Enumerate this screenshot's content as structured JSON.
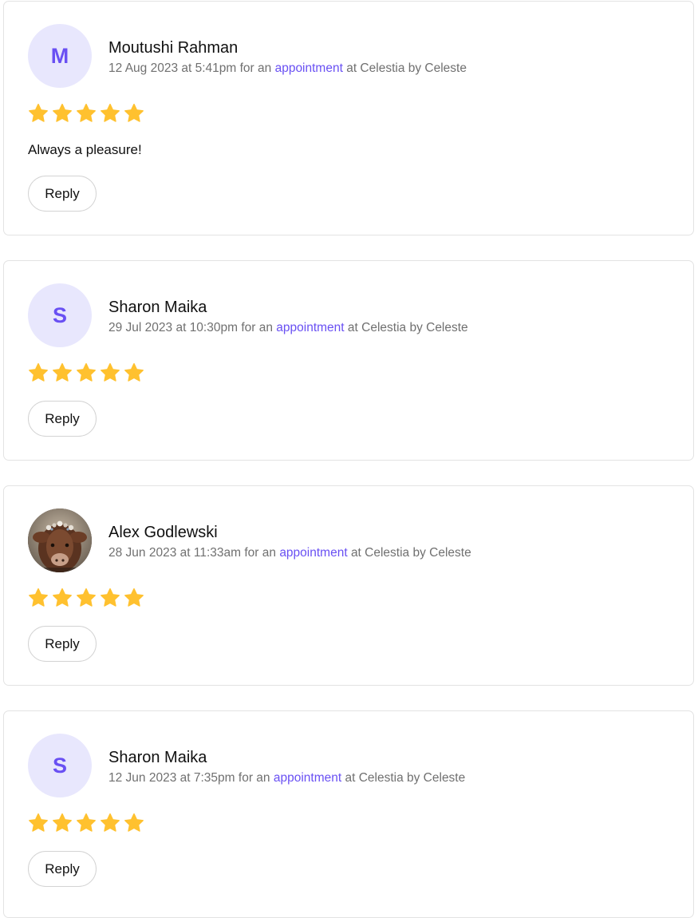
{
  "colors": {
    "accent": "#6950f3",
    "avatar_bg": "#e8e7fd",
    "star": "#ffc12f",
    "meta_text": "#707070",
    "border": "#e3e3e3"
  },
  "reviews": [
    {
      "avatar_type": "initial",
      "avatar_initial": "M",
      "name": "Moutushi Rahman",
      "date": "12 Aug 2023 at 5:41pm",
      "meta_for": "for an",
      "link_label": "appointment",
      "meta_at": "at Celestia by Celeste",
      "rating": 5,
      "text": "Always a pleasure!",
      "reply_label": "Reply"
    },
    {
      "avatar_type": "initial",
      "avatar_initial": "S",
      "name": "Sharon Maika",
      "date": "29 Jul 2023 at 10:30pm",
      "meta_for": "for an",
      "link_label": "appointment",
      "meta_at": "at Celestia by Celeste",
      "rating": 5,
      "text": "",
      "reply_label": "Reply"
    },
    {
      "avatar_type": "photo",
      "avatar_initial": "",
      "name": "Alex Godlewski",
      "date": "28 Jun 2023 at 11:33am",
      "meta_for": "for an",
      "link_label": "appointment",
      "meta_at": "at Celestia by Celeste",
      "rating": 5,
      "text": "",
      "reply_label": "Reply"
    },
    {
      "avatar_type": "initial",
      "avatar_initial": "S",
      "name": "Sharon Maika",
      "date": "12 Jun 2023 at 7:35pm",
      "meta_for": "for an",
      "link_label": "appointment",
      "meta_at": "at Celestia by Celeste",
      "rating": 5,
      "text": "",
      "reply_label": "Reply"
    }
  ]
}
